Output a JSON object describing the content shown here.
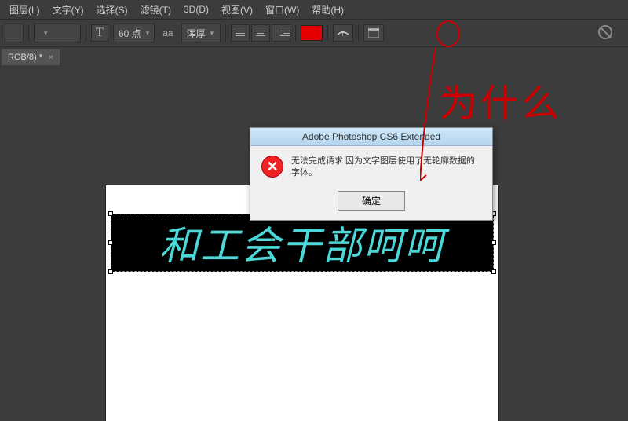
{
  "menu": {
    "layer": "图层(L)",
    "text": "文字(Y)",
    "select": "选择(S)",
    "filter": "滤镜(T)",
    "three_d": "3D(D)",
    "view": "视图(V)",
    "window": "窗口(W)",
    "help": "帮助(H)"
  },
  "options": {
    "font_size": "60 点",
    "aa_label": "aa",
    "aa_mode": "浑厚",
    "color": "#e60000"
  },
  "tabs": {
    "doc1": "RGB/8) *"
  },
  "canvas": {
    "text_content": "和工会干部呵呵"
  },
  "dialog": {
    "title": "Adobe Photoshop CS6 Extended",
    "message": "无法完成请求 因为文字图层使用了无轮廓数据的字体。",
    "ok": "确定"
  },
  "annotation": {
    "text": "为什么"
  }
}
